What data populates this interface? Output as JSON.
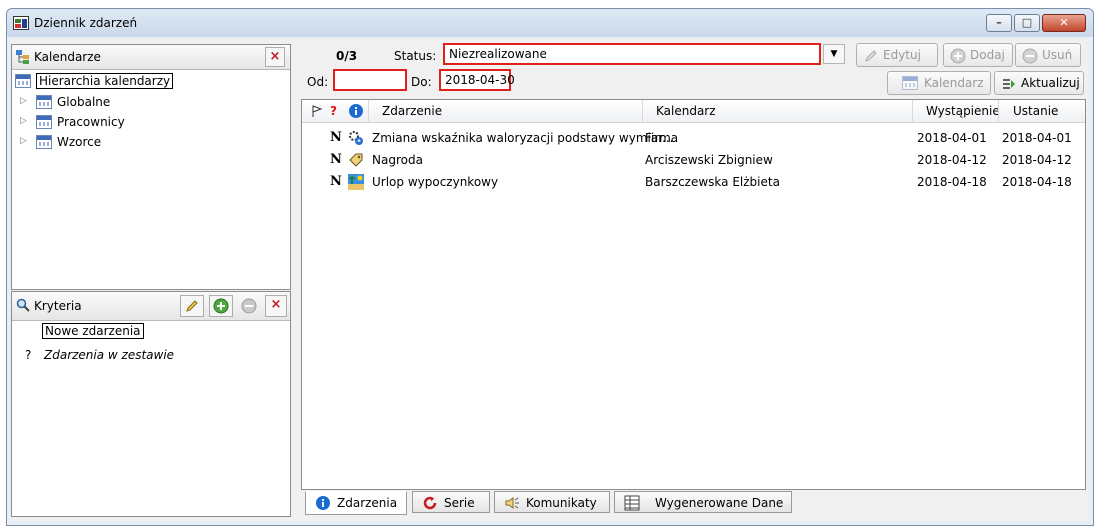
{
  "window": {
    "title": "Dziennik zdarzeń"
  },
  "calendars_panel": {
    "title": "Kalendarze",
    "root": "Hierarchia kalendarzy",
    "items": [
      {
        "label": "Globalne"
      },
      {
        "label": "Pracownicy"
      },
      {
        "label": "Wzorce"
      }
    ]
  },
  "criteria_panel": {
    "title": "Kryteria",
    "items": [
      {
        "label": "Nowe zdarzenia",
        "prefix": ""
      },
      {
        "label": "Zdarzenia w zestawie",
        "prefix": "?"
      }
    ]
  },
  "filter": {
    "count": "0/3",
    "status_label": "Status:",
    "status_value": "Niezrealizowane",
    "from_label": "Od:",
    "from_value": "",
    "to_label": "Do:",
    "to_value": "2018-04-30"
  },
  "toolbar": {
    "edit": "Edytuj",
    "add": "Dodaj",
    "remove": "Usuń",
    "calendar": "Kalendarz",
    "refresh": "Aktualizuj"
  },
  "table": {
    "columns": {
      "flag": "",
      "q": "?",
      "info": "",
      "event": "Zdarzenie",
      "calendar": "Kalendarz",
      "occurrence": "Wystąpienie",
      "end": "Ustanie"
    },
    "rows": [
      {
        "status": "N",
        "event": "Zmiana wskaźnika waloryzacji podstawy wymiar...",
        "calendar": "Firma",
        "occurrence": "2018-04-01",
        "end": "2018-04-01",
        "icon": "settings-icon"
      },
      {
        "status": "N",
        "event": "Nagroda",
        "calendar": "Arciszewski Zbigniew",
        "occurrence": "2018-04-12",
        "end": "2018-04-12",
        "icon": "tag-icon"
      },
      {
        "status": "N",
        "event": "Urlop wypoczynkowy",
        "calendar": "Barszczewska Elżbieta",
        "occurrence": "2018-04-18",
        "end": "2018-04-18",
        "icon": "holiday-icon"
      }
    ]
  },
  "tabs": [
    {
      "label": "Zdarzenia",
      "icon": "info-icon",
      "active": true
    },
    {
      "label": "Serie",
      "icon": "series-icon",
      "active": false
    },
    {
      "label": "Komunikaty",
      "icon": "speaker-icon",
      "active": false
    },
    {
      "label": "Wygenerowane Dane",
      "icon": "grid-icon",
      "active": false
    }
  ],
  "colors": {
    "highlight_red": "#e0201b",
    "title_bar": "#c9d8ea",
    "accent_blue": "#1a6bd1"
  }
}
